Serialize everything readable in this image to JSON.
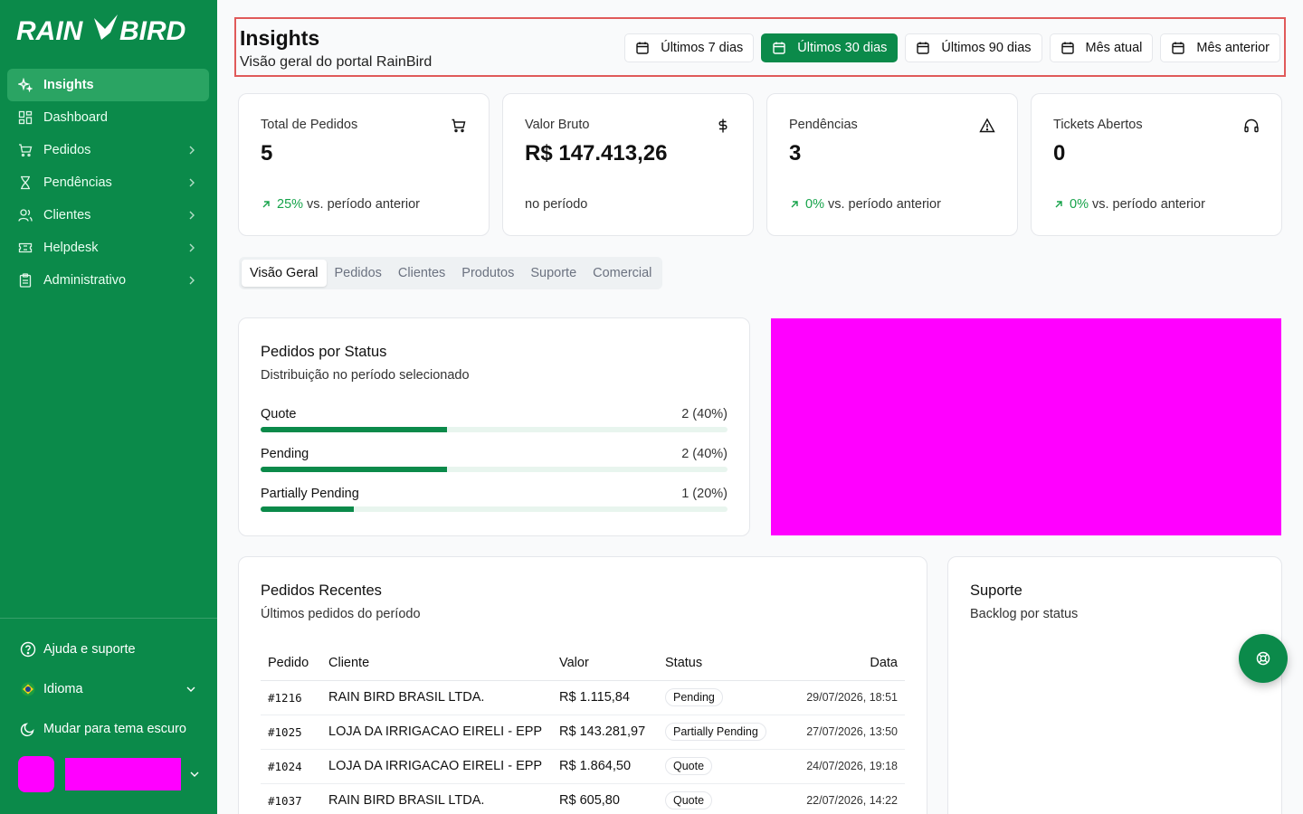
{
  "brand": {
    "name": "RAIN BIRD",
    "accent": "#0b8a4a"
  },
  "sidebar": {
    "items": [
      {
        "label": "Insights",
        "icon": "sparkles-icon",
        "active": true
      },
      {
        "label": "Dashboard",
        "icon": "grid-icon"
      },
      {
        "label": "Pedidos",
        "icon": "cart-icon"
      },
      {
        "label": "Pendências",
        "icon": "hourglass-icon"
      },
      {
        "label": "Clientes",
        "icon": "users-icon"
      },
      {
        "label": "Helpdesk",
        "icon": "ticket-icon"
      },
      {
        "label": "Administrativo",
        "icon": "clipboard-icon"
      }
    ],
    "bottom": {
      "help": "Ajuda e suporte",
      "language": "Idioma",
      "theme": "Mudar para tema escuro"
    }
  },
  "header": {
    "title": "Insights",
    "subtitle": "Visão geral do portal RainBird",
    "ranges": [
      "Últimos 7 dias",
      "Últimos 30 dias",
      "Últimos 90 dias",
      "Mês atual",
      "Mês anterior"
    ],
    "active_range": "Últimos 30 dias"
  },
  "stats": [
    {
      "label": "Total de Pedidos",
      "value": "5",
      "pct": "25%",
      "trend": "vs. período anterior",
      "icon": "cart-icon"
    },
    {
      "label": "Valor Bruto",
      "value": "R$ 147.413,26",
      "pct": "",
      "trend": "no período",
      "icon": "dollar-icon"
    },
    {
      "label": "Pendências",
      "value": "3",
      "pct": "0%",
      "trend": "vs. período anterior",
      "icon": "warning-icon"
    },
    {
      "label": "Tickets Abertos",
      "value": "0",
      "pct": "0%",
      "trend": "vs. período anterior",
      "icon": "headphones-icon"
    }
  ],
  "tabs": [
    "Visão Geral",
    "Pedidos",
    "Clientes",
    "Produtos",
    "Suporte",
    "Comercial"
  ],
  "status_card": {
    "title": "Pedidos por Status",
    "subtitle": "Distribuição no período selecionado",
    "rows": [
      {
        "name": "Quote",
        "count": "2 (40%)",
        "fraction": 0.4
      },
      {
        "name": "Pending",
        "count": "2 (40%)",
        "fraction": 0.4
      },
      {
        "name": "Partially Pending",
        "count": "1 (20%)",
        "fraction": 0.2
      }
    ]
  },
  "orders": {
    "title": "Pedidos Recentes",
    "subtitle": "Últimos pedidos do período",
    "columns": [
      "Pedido",
      "Cliente",
      "Valor",
      "Status",
      "Data"
    ],
    "rows": [
      {
        "id": "#1216",
        "client": "RAIN BIRD BRASIL LTDA.",
        "value": "R$ 1.115,84",
        "status": "Pending",
        "date": "29/07/2026, 18:51"
      },
      {
        "id": "#1025",
        "client": "LOJA DA IRRIGACAO EIRELI - EPP",
        "value": "R$ 143.281,97",
        "status": "Partially Pending",
        "date": "27/07/2026, 13:50"
      },
      {
        "id": "#1024",
        "client": "LOJA DA IRRIGACAO EIRELI - EPP",
        "value": "R$ 1.864,50",
        "status": "Quote",
        "date": "24/07/2026, 19:18"
      },
      {
        "id": "#1037",
        "client": "RAIN BIRD BRASIL LTDA.",
        "value": "R$ 605,80",
        "status": "Quote",
        "date": "22/07/2026, 14:22"
      }
    ]
  },
  "support": {
    "title": "Suporte",
    "subtitle": "Backlog por status"
  }
}
